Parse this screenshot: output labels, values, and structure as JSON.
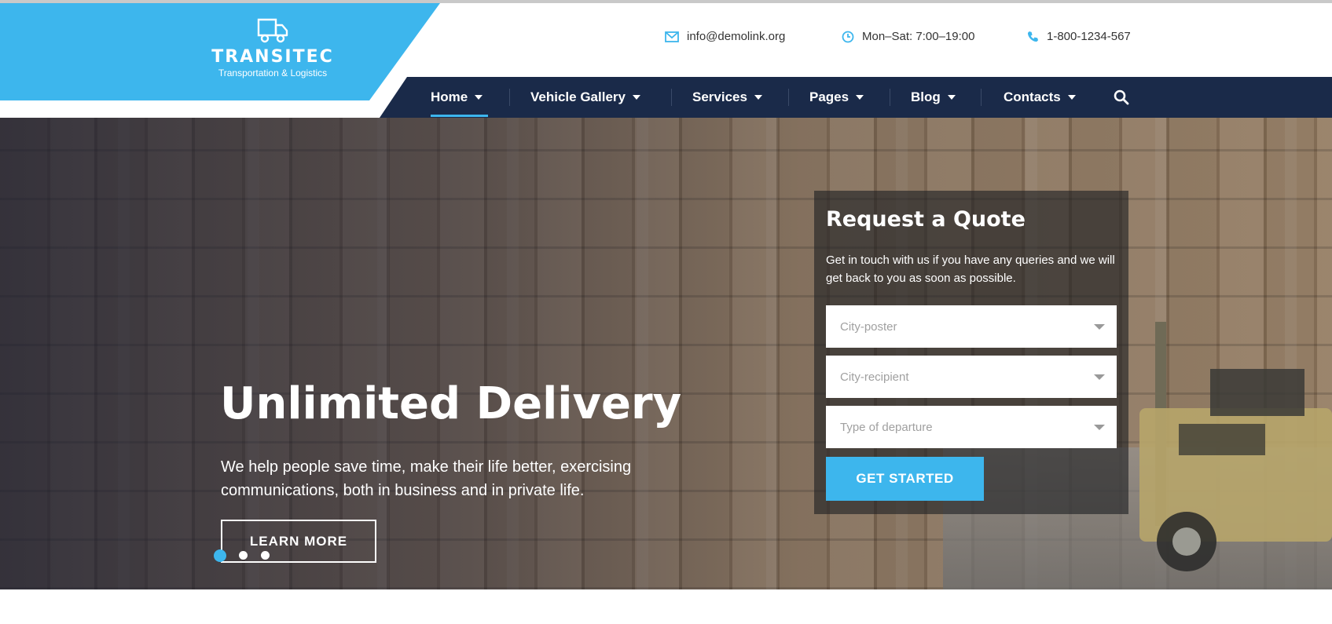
{
  "logo": {
    "title": "TRANSITEC",
    "subtitle": "Transportation & Logistics"
  },
  "contacts": {
    "email": "info@demolink.org",
    "hours": "Mon–Sat: 7:00–19:00",
    "phone": "1-800-1234-567"
  },
  "nav": {
    "items": [
      {
        "label": "Home",
        "active": true
      },
      {
        "label": "Vehicle Gallery"
      },
      {
        "label": "Services"
      },
      {
        "label": "Pages"
      },
      {
        "label": "Blog"
      },
      {
        "label": "Contacts"
      }
    ]
  },
  "hero": {
    "title": "Unlimited Delivery",
    "text": "We help people save time, make their life better, exercising communications, both in business and in private life.",
    "button": "LEARN MORE",
    "slides": 3,
    "active_slide": 1
  },
  "quote": {
    "title": "Request a Quote",
    "text": "Get in touch with us if you have any queries and we will get back to you as soon as possible.",
    "fields": [
      {
        "placeholder": "City-poster"
      },
      {
        "placeholder": "City-recipient"
      },
      {
        "placeholder": "Type of departure"
      }
    ],
    "button": "GET STARTED"
  },
  "colors": {
    "accent": "#3db6ed",
    "nav_bg": "#1a2a49"
  }
}
